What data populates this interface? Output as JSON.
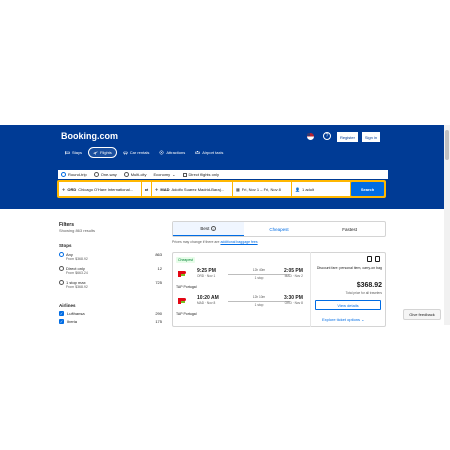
{
  "header": {
    "logo": "Booking.com",
    "help_label": "?",
    "register_label": "Register",
    "signin_label": "Sign in",
    "nav": [
      {
        "label": "Stays",
        "icon": "bed-icon"
      },
      {
        "label": "Flights",
        "icon": "plane-icon",
        "active": true
      },
      {
        "label": "Car rentals",
        "icon": "car-icon"
      },
      {
        "label": "Attractions",
        "icon": "attractions-icon"
      },
      {
        "label": "Airport taxis",
        "icon": "taxi-icon"
      }
    ]
  },
  "search": {
    "trip_types": [
      "Round-trip",
      "One-way",
      "Multi-city"
    ],
    "selected_trip": "Round-trip",
    "cabin": "Economy",
    "direct_only_label": "Direct flights only",
    "from_code": "ORD",
    "from_name": "Chicago O'Hare International...",
    "to_code": "MAD",
    "to_name": "Adolfo Suarez Madrid-Baraj...",
    "dates": "Fri, Nov 1 – Fri, Nov 8",
    "travelers": "1 adult",
    "search_label": "Search"
  },
  "filters": {
    "title": "Filters",
    "showing": "Showing 863 results",
    "stops_title": "Stops",
    "stops": [
      {
        "label": "Any",
        "from": "From $368.92",
        "count": "863"
      },
      {
        "label": "Direct only",
        "from": "From $663.24",
        "count": "12"
      },
      {
        "label": "1 stop max",
        "from": "From $368.92",
        "count": "725"
      }
    ],
    "airlines_title": "Airlines",
    "airlines": [
      {
        "label": "Lufthansa",
        "count": "290"
      },
      {
        "label": "Iberia",
        "count": "175"
      }
    ]
  },
  "results": {
    "tabs": [
      "Best",
      "Cheapest",
      "Fastest"
    ],
    "note_text": "Prices may change if there are ",
    "note_link": "additional baggage fees",
    "badge": "Cheapest",
    "legs": [
      {
        "dep_time": "9:25 PM",
        "dep_info": "ORD · Nov 1",
        "duration": "12h 40m",
        "stops": "1 stop",
        "arr_time": "2:05 PM",
        "arr_info": "MAD · Nov 2"
      },
      {
        "dep_time": "10:20 AM",
        "dep_info": "MAD · Nov 8",
        "duration": "12h 10m",
        "stops": "1 stop",
        "arr_time": "3:30 PM",
        "arr_info": "ORD · Nov 8"
      }
    ],
    "airline_name": "TAP Portugal",
    "included_note": "Discount fare: personal item, carry-on bag",
    "price": "$368.92",
    "price_sub": "Total price for all travelers",
    "view_details": "View details",
    "explore_label": "Explore ticket options"
  },
  "feedback_label": "Give feedback",
  "colors": {
    "brand": "#003b95",
    "accent": "#006ce4",
    "highlight": "#ffb700"
  }
}
